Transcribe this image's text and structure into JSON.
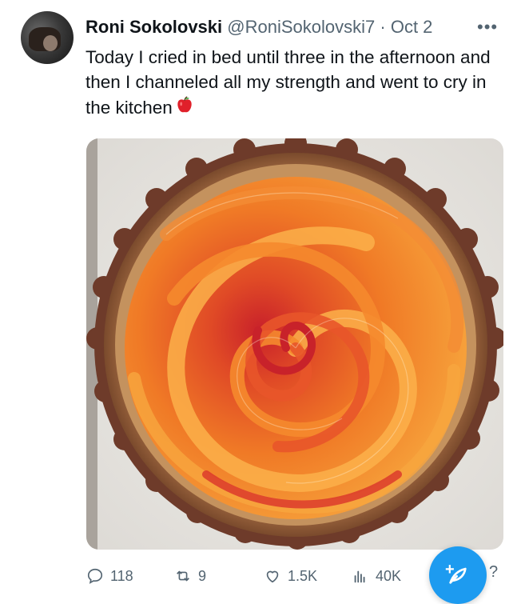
{
  "tweet": {
    "author_name": "Roni Sokolovski",
    "handle": "@RoniSokolovski7",
    "separator": "·",
    "date": "Oct 2",
    "more": "•••",
    "text": "Today I cried in bed until three in the afternoon and then I channeled all my strength and went to cry in the kitchen",
    "emoji": "red-apple-icon",
    "media": "apple-rose-tart-photo"
  },
  "actions": {
    "reply_count": "118",
    "retweet_count": "9",
    "like_count": "1.5K",
    "views_count": "40K",
    "edge_glyph": "?"
  },
  "colors": {
    "accent": "#1d9bf0",
    "secondary_text": "#536471",
    "primary_text": "#0f1419"
  },
  "icons": {
    "reply": "reply-icon",
    "retweet": "retweet-icon",
    "like": "heart-icon",
    "views": "views-icon",
    "compose": "compose-icon"
  }
}
